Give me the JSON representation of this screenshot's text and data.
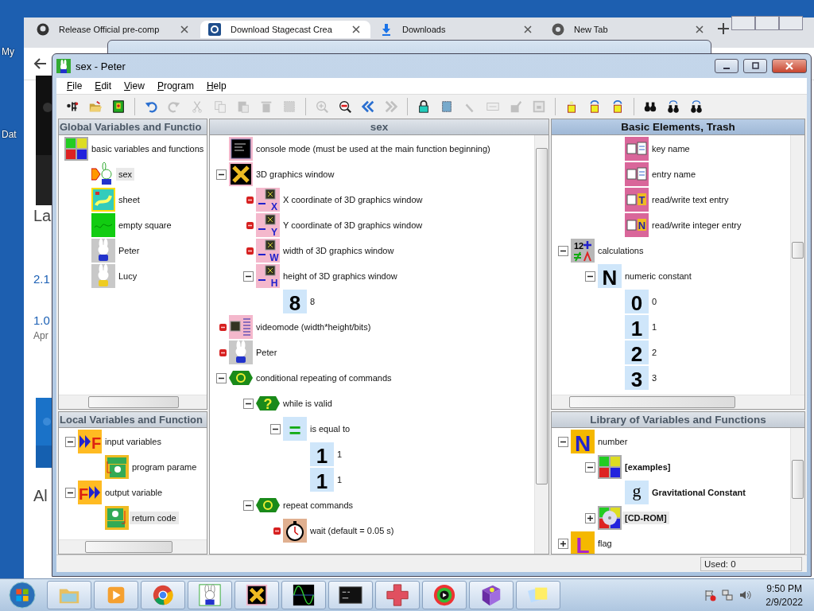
{
  "desktop": {
    "icon_labels": [
      "My",
      "Dat"
    ]
  },
  "browser": {
    "tabs": [
      {
        "label": "Release Official pre-comp",
        "kind": "github",
        "selected": false
      },
      {
        "label": "Download Stagecast Crea",
        "kind": "stagecast",
        "selected": true
      },
      {
        "label": "Downloads",
        "kind": "download",
        "selected": false
      },
      {
        "label": "New Tab",
        "kind": "chrome",
        "selected": false
      }
    ],
    "page_fragments": [
      {
        "text": "La",
        "kind": "heading"
      },
      {
        "text": "2.1",
        "kind": "version"
      },
      {
        "text": "1.0",
        "kind": "version"
      },
      {
        "text": "Apr",
        "kind": "date"
      },
      {
        "text": "Al",
        "kind": "heading"
      }
    ]
  },
  "window": {
    "title": "sex - Peter",
    "menu": [
      "File",
      "Edit",
      "View",
      "Program",
      "Help"
    ],
    "toolbar": [
      {
        "kind": "tree",
        "disabled": false
      },
      {
        "kind": "open",
        "disabled": false
      },
      {
        "kind": "book",
        "disabled": false
      },
      {
        "kind": "separator"
      },
      {
        "kind": "undo",
        "disabled": false
      },
      {
        "kind": "redo",
        "disabled": true
      },
      {
        "kind": "cut",
        "disabled": true
      },
      {
        "kind": "copy",
        "disabled": true
      },
      {
        "kind": "paste",
        "disabled": true
      },
      {
        "kind": "delete",
        "disabled": true
      },
      {
        "kind": "select",
        "disabled": true
      },
      {
        "kind": "separator"
      },
      {
        "kind": "zoom-in",
        "disabled": true
      },
      {
        "kind": "zoom-out",
        "disabled": false
      },
      {
        "kind": "back",
        "disabled": false
      },
      {
        "kind": "forward",
        "disabled": true
      },
      {
        "kind": "separator"
      },
      {
        "kind": "lock",
        "disabled": false
      },
      {
        "kind": "grid",
        "disabled": false
      },
      {
        "kind": "pen",
        "disabled": true
      },
      {
        "kind": "textbox",
        "disabled": true
      },
      {
        "kind": "edit",
        "disabled": true
      },
      {
        "kind": "frame",
        "disabled": true
      },
      {
        "kind": "separator"
      },
      {
        "kind": "flag",
        "disabled": false
      },
      {
        "kind": "flag-prev",
        "disabled": false
      },
      {
        "kind": "flag-next",
        "disabled": false
      },
      {
        "kind": "separator"
      },
      {
        "kind": "find",
        "disabled": false
      },
      {
        "kind": "find-prev",
        "disabled": false
      },
      {
        "kind": "find-next",
        "disabled": false
      }
    ],
    "panes": [
      {
        "title": "Global Variables and Functio",
        "active": false,
        "tree": [
          {
            "label": "basic variables and functions",
            "kind": "palette",
            "selected": false,
            "children": [
              {
                "label": "sex",
                "kind": "rabbit-arrow",
                "selected": true
              },
              {
                "label": "sheet",
                "kind": "sheet",
                "selected": false
              },
              {
                "label": "empty square",
                "kind": "green-square",
                "selected": false
              },
              {
                "label": "Peter",
                "kind": "rabbit",
                "selected": false
              },
              {
                "label": "Lucy",
                "kind": "rabbit-girl",
                "selected": false
              }
            ]
          }
        ]
      },
      {
        "title": "Local Variables and Function",
        "active": false,
        "tree": [
          {
            "label": "input variables",
            "kind": "input-var",
            "glyph": "F",
            "expanded": true,
            "selected": false,
            "children": [
              {
                "label": "program parame",
                "kind": "param",
                "selected": false
              }
            ]
          },
          {
            "label": "output variable",
            "kind": "output-var",
            "glyph": "F",
            "expanded": true,
            "selected": false,
            "children": [
              {
                "label": "return code",
                "kind": "retcode",
                "selected": true
              }
            ]
          }
        ]
      },
      {
        "title": "sex",
        "active": false,
        "tree": [
          {
            "label": "console mode (must be used at the main function beginning)",
            "kind": "console",
            "selected": false
          },
          {
            "label": "3D graphics window",
            "kind": "cross",
            "expanded": true,
            "selected": false,
            "children": [
              {
                "label": "X coordinate of 3D graphics window",
                "kind": "coord",
                "glyph": "X",
                "marker": true,
                "selected": false
              },
              {
                "label": "Y coordinate of 3D graphics window",
                "kind": "coord",
                "glyph": "Y",
                "marker": true,
                "selected": false
              },
              {
                "label": "width of 3D graphics window",
                "kind": "coord",
                "glyph": "W",
                "marker": true,
                "selected": false
              },
              {
                "label": "height of 3D graphics window",
                "kind": "coord",
                "glyph": "H",
                "expanded": true,
                "selected": false,
                "children": [
                  {
                    "label": "8",
                    "kind": "digit",
                    "glyph": "8",
                    "selected": false
                  }
                ]
              }
            ]
          },
          {
            "label": "videomode (width*height/bits)",
            "kind": "videomode",
            "marker": true,
            "selected": false
          },
          {
            "label": "Peter",
            "kind": "rabbit",
            "marker": true,
            "selected": false
          },
          {
            "label": "conditional repeating of commands",
            "kind": "loop",
            "expanded": true,
            "selected": false,
            "children": [
              {
                "label": "while is valid",
                "kind": "condition",
                "glyph": "?",
                "expanded": true,
                "selected": false,
                "children": [
                  {
                    "label": "is equal to",
                    "kind": "digit",
                    "glyph": "=",
                    "expanded": true,
                    "selected": false,
                    "children": [
                      {
                        "label": "1",
                        "kind": "digit",
                        "glyph": "1",
                        "selected": false
                      },
                      {
                        "label": "1",
                        "kind": "digit",
                        "glyph": "1",
                        "selected": false
                      }
                    ]
                  }
                ]
              },
              {
                "label": "repeat commands",
                "kind": "loop",
                "expanded": true,
                "selected": false,
                "children": [
                  {
                    "label": "wait (default = 0.05 s)",
                    "kind": "timer",
                    "marker": true,
                    "selected": false
                  }
                ]
              }
            ]
          }
        ]
      },
      {
        "title": "Basic Elements, Trash",
        "active": true,
        "tree": [
          {
            "children": [
              {
                "children": [
                  {
                    "label": "key name",
                    "kind": "key",
                    "selected": false
                  },
                  {
                    "label": "entry name",
                    "kind": "key",
                    "selected": false
                  },
                  {
                    "label": "read/write text entry",
                    "kind": "key-letter",
                    "glyph": "T",
                    "selected": false
                  },
                  {
                    "label": "read/write integer entry",
                    "kind": "key-letter",
                    "glyph": "N",
                    "selected": false
                  }
                ]
              }
            ]
          },
          {
            "label": "calculations",
            "kind": "calc",
            "glyph": "12",
            "expanded": true,
            "selected": false,
            "children": [
              {
                "label": "numeric constant",
                "kind": "digit",
                "glyph": "N",
                "expanded": true,
                "selected": false,
                "children": [
                  {
                    "label": "0",
                    "kind": "digit",
                    "glyph": "0",
                    "selected": false
                  },
                  {
                    "label": "1",
                    "kind": "digit",
                    "glyph": "1",
                    "selected": false
                  },
                  {
                    "label": "2",
                    "kind": "digit",
                    "glyph": "2",
                    "selected": false
                  },
                  {
                    "label": "3",
                    "kind": "digit",
                    "glyph": "3",
                    "selected": false
                  }
                ]
              }
            ]
          }
        ]
      },
      {
        "title": "Library of Variables and Functions",
        "active": false,
        "tree": [
          {
            "label": "number",
            "kind": "yellow-letter",
            "glyph": "N",
            "expanded": true,
            "selected": false,
            "children": [
              {
                "label": "[examples]",
                "kind": "palette",
                "expanded": true,
                "bold": true,
                "selected": false,
                "children": [
                  {
                    "label": "Gravitational Constant",
                    "kind": "serif-letter",
                    "glyph": "g",
                    "bold": true,
                    "selected": false
                  }
                ]
              },
              {
                "label": "[CD-ROM]",
                "kind": "cdrom",
                "expanded": false,
                "bold": true,
                "selected": true
              }
            ]
          },
          {
            "label": "flag",
            "kind": "yellow-letter",
            "glyph": "L",
            "expanded": false,
            "selected": false
          }
        ]
      }
    ],
    "status_bar": {
      "used": "Used: 0"
    }
  },
  "taskbar": {
    "apps": [
      {
        "kind": "folder"
      },
      {
        "kind": "media"
      },
      {
        "kind": "chrome"
      },
      {
        "kind": "rabbit"
      },
      {
        "kind": "cross"
      },
      {
        "kind": "wave"
      },
      {
        "kind": "terminal"
      },
      {
        "kind": "plus-grid"
      },
      {
        "kind": "film"
      },
      {
        "kind": "help-book"
      },
      {
        "kind": "notes"
      }
    ],
    "time": "9:50 PM",
    "date": "2/9/2022"
  }
}
